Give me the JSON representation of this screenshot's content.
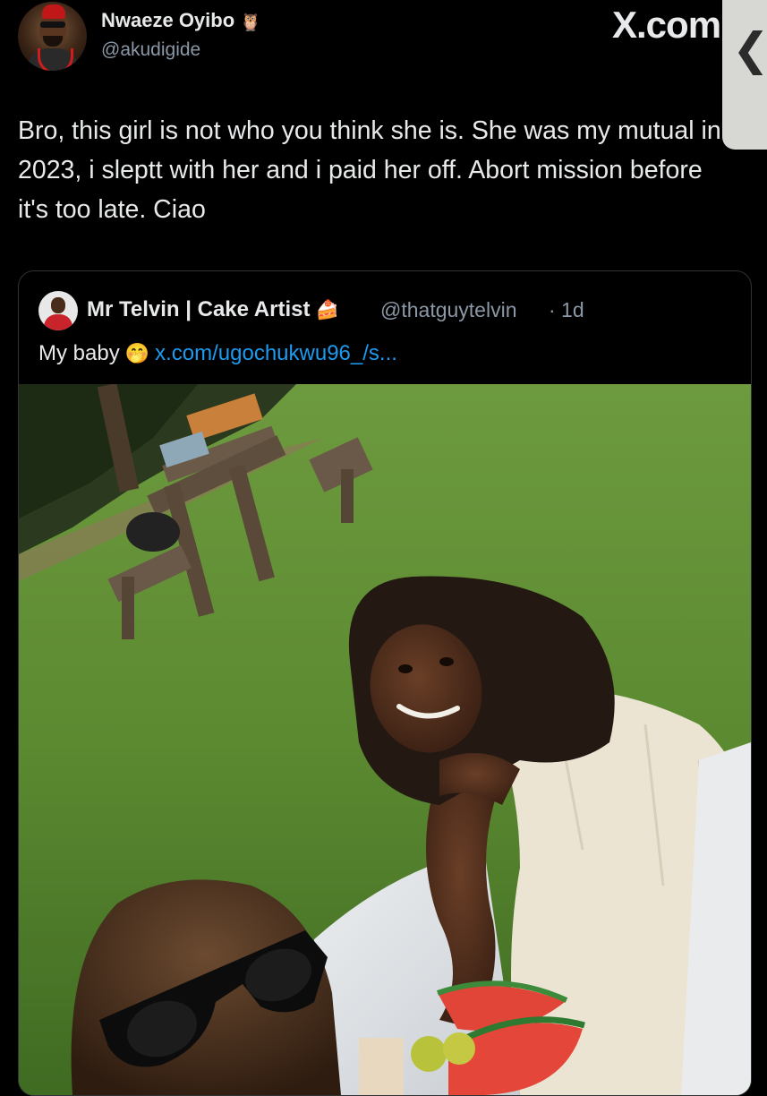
{
  "tweet": {
    "display_name": "Nwaeze Oyibo",
    "name_emoji": "🦉",
    "handle": "@akudigide",
    "brand_watermark": "X.com",
    "text": "Bro, this girl is not who you think she is. She was my mutual in 2023, i sleptt with her and i paid her off. Abort mission before it's too late. Ciao",
    "side_tab_icon": "chevron-left-icon"
  },
  "quoted": {
    "display_name": "Mr Telvin | Cake Artist",
    "name_emoji": "🍰",
    "handle": "@thatguytelvin",
    "time": "· 1d",
    "text": "My baby",
    "text_emoji": "🤭",
    "link": "x.com/ugochukwu96_/s..."
  },
  "colors": {
    "background": "#000000",
    "text": "#e7e9ea",
    "secondary_text": "#8b98a5",
    "link": "#1d9bf0",
    "border": "#2f3336"
  }
}
